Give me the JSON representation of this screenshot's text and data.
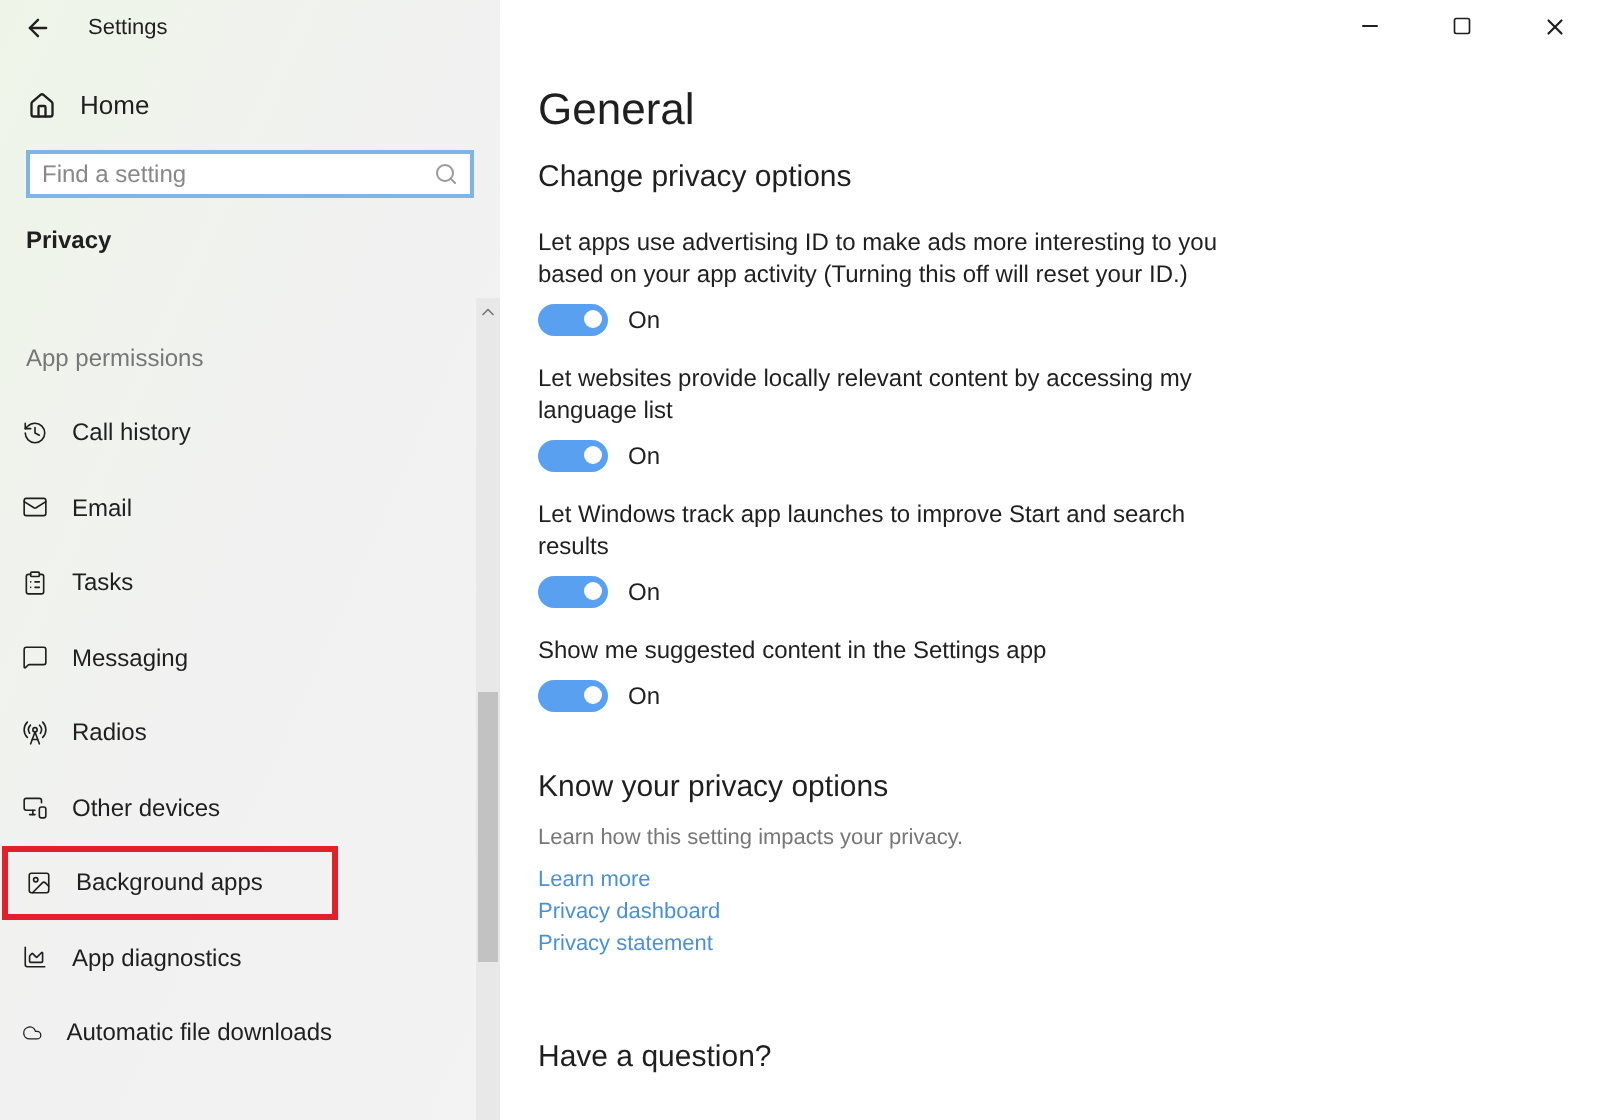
{
  "window": {
    "title": "Settings"
  },
  "sidebar": {
    "home": "Home",
    "search": {
      "placeholder": "Find a setting"
    },
    "section": "Privacy",
    "group": "App permissions",
    "items": [
      {
        "label": "Call history",
        "kind": "history",
        "highlighted": false
      },
      {
        "label": "Email",
        "kind": "mail",
        "highlighted": false
      },
      {
        "label": "Tasks",
        "kind": "tasks",
        "highlighted": false
      },
      {
        "label": "Messaging",
        "kind": "message",
        "highlighted": false
      },
      {
        "label": "Radios",
        "kind": "radio",
        "highlighted": false
      },
      {
        "label": "Other devices",
        "kind": "devices",
        "highlighted": false
      },
      {
        "label": "Background apps",
        "kind": "background",
        "highlighted": true
      },
      {
        "label": "App diagnostics",
        "kind": "diagnostics",
        "highlighted": false
      },
      {
        "label": "Automatic file downloads",
        "kind": "cloud",
        "highlighted": false
      }
    ]
  },
  "page": {
    "title": "General",
    "heading": "Change privacy options",
    "options": [
      {
        "text": "Let apps use advertising ID to make ads more interesting to you based on your app activity (Turning this off will reset your ID.)",
        "on": true,
        "state": "On"
      },
      {
        "text": "Let websites provide locally relevant content by accessing my language list",
        "on": true,
        "state": "On"
      },
      {
        "text": "Let Windows track app launches to improve Start and search results",
        "on": true,
        "state": "On"
      },
      {
        "text": "Show me suggested content in the Settings app",
        "on": true,
        "state": "On"
      }
    ],
    "know": {
      "heading": "Know your privacy options",
      "text": "Learn how this setting impacts your privacy.",
      "links": [
        "Learn more",
        "Privacy dashboard",
        "Privacy statement"
      ]
    },
    "question": "Have a question?"
  }
}
